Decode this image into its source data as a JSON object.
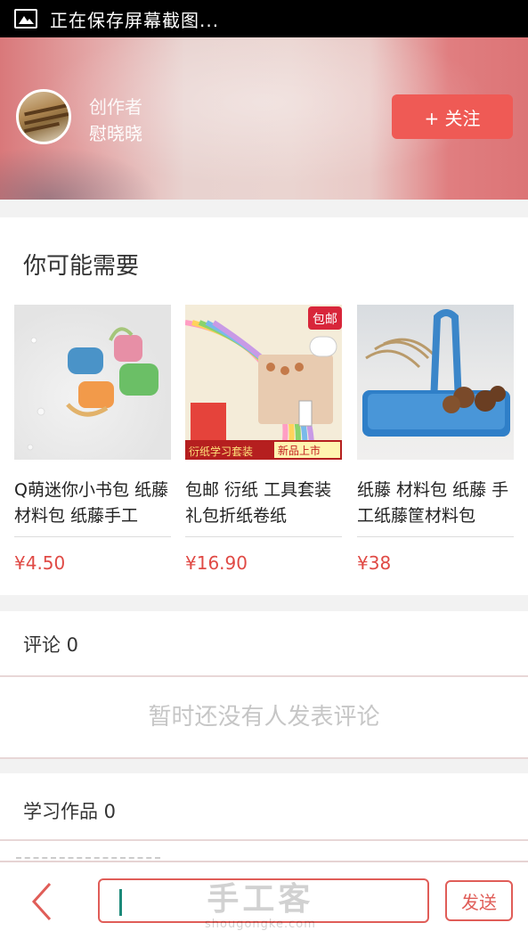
{
  "status_bar": {
    "text": "正在保存屏幕截图...",
    "icon": "image-icon"
  },
  "header": {
    "creator_label": "创作者",
    "creator_name": "慰晓晓",
    "follow_label": "+ 关注",
    "accent_color": "#ef5a55"
  },
  "recommend": {
    "title": "你可能需要",
    "products": [
      {
        "name": "Q萌迷你小书包 纸藤 材料包 纸藤手工",
        "price": "¥4.50"
      },
      {
        "name": "包邮 衍纸 工具套装 礼包折纸卷纸",
        "price": "¥16.90",
        "badge": "包邮",
        "banner_left": "衍纸学习套装",
        "banner_right": "新品上市"
      },
      {
        "name": "纸藤 材料包 纸藤 手工纸藤筐材料包",
        "price": "¥38"
      }
    ]
  },
  "comments": {
    "title": "评论 0",
    "empty_text": "暂时还没有人发表评论"
  },
  "works": {
    "title": "学习作品 0"
  },
  "bottom_bar": {
    "send_label": "发送",
    "back_icon": "chevron-left-icon",
    "watermark_logo": "手工客",
    "watermark_url": "shougongke.com"
  }
}
